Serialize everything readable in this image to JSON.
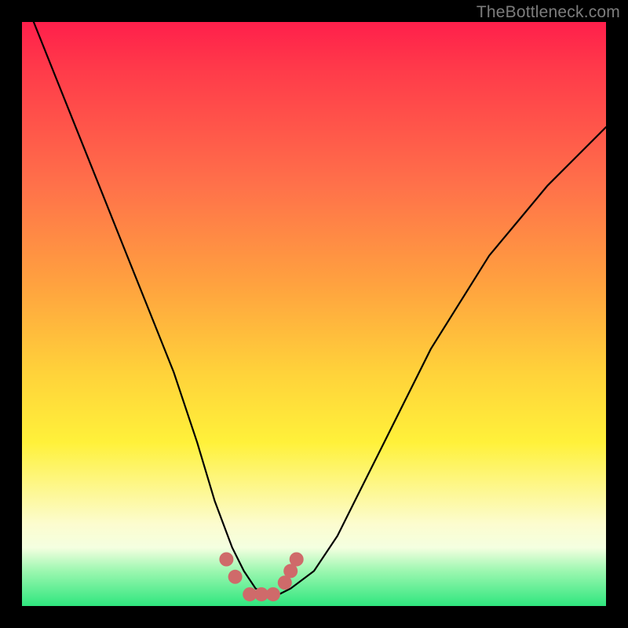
{
  "watermark": "TheBottleneck.com",
  "chart_data": {
    "type": "line",
    "title": "",
    "xlabel": "",
    "ylabel": "",
    "xlim": [
      0,
      100
    ],
    "ylim": [
      0,
      100
    ],
    "series": [
      {
        "name": "bottleneck-curve",
        "x": [
          2,
          6,
          10,
          14,
          18,
          22,
          26,
          30,
          33,
          36,
          38,
          40,
          42,
          44,
          46,
          50,
          54,
          58,
          62,
          66,
          70,
          75,
          80,
          85,
          90,
          95,
          100
        ],
        "y": [
          100,
          90,
          80,
          70,
          60,
          50,
          40,
          28,
          18,
          10,
          6,
          3,
          2,
          2,
          3,
          6,
          12,
          20,
          28,
          36,
          44,
          52,
          60,
          66,
          72,
          77,
          82
        ]
      }
    ],
    "markers": {
      "name": "highlight-cluster",
      "x": [
        35,
        36.5,
        39,
        41,
        43,
        45,
        46,
        47
      ],
      "y": [
        8,
        5,
        2,
        2,
        2,
        4,
        6,
        8
      ]
    },
    "gradient_stops": [
      {
        "pos": 0,
        "color": "#ff1f4b"
      },
      {
        "pos": 28,
        "color": "#ff714a"
      },
      {
        "pos": 60,
        "color": "#ffd23a"
      },
      {
        "pos": 86,
        "color": "#fcfccf"
      },
      {
        "pos": 100,
        "color": "#2fe67e"
      }
    ]
  }
}
